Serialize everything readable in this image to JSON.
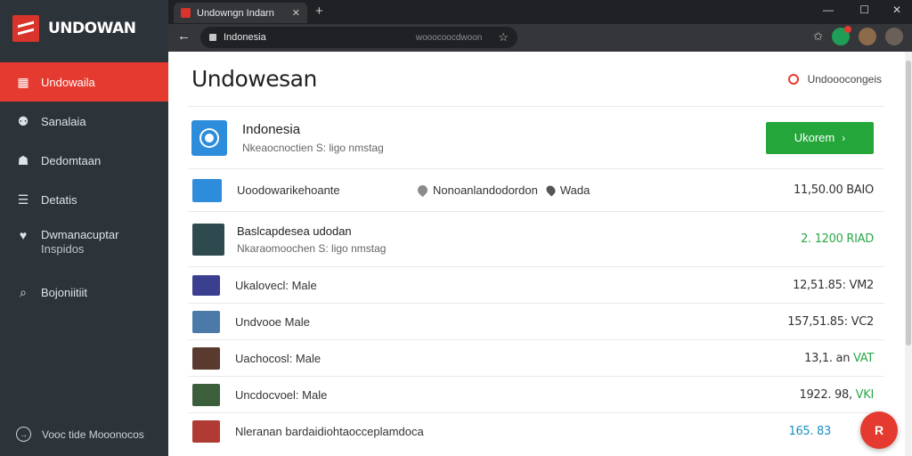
{
  "app": {
    "logo_text": "UNDOWAN"
  },
  "sidebar": {
    "items": [
      {
        "label": "Undowaila",
        "icon": "grid-icon"
      },
      {
        "label": "Sanalaia",
        "icon": "users-icon"
      },
      {
        "label": "Dedomtaan",
        "icon": "user-icon"
      },
      {
        "label": "Detatis",
        "icon": "list-icon"
      },
      {
        "label": "Dwmanacuptar",
        "label2": "Inspidos",
        "icon": "heart-icon"
      },
      {
        "label": "Bojoniitiit",
        "icon": "search-icon"
      }
    ],
    "footer_label": "Vooc tide Mooonocos"
  },
  "browser": {
    "tab_title": "Undowngn Indarn",
    "address": "Indonesia",
    "address_right": "wooocoocdwoon"
  },
  "page": {
    "title": "Undowesan",
    "header_link": "Undooocongeis",
    "hero": {
      "title": "Indonesia",
      "subtitle": "Nkeaocnoctien S: ligo nmstag",
      "cta": "Ukorem"
    },
    "rows": [
      {
        "name": "Uoodowarikehoante",
        "location": "Nonoanlandodordon",
        "location2": "Wada",
        "value": "11,50.00 BAIO",
        "value_color": "dark"
      },
      {
        "name": "Baslcapdesea udodan",
        "subtitle": "Nkaraomoochen S: ligo nmstag",
        "value": "2. 1200 RIAD",
        "value_color": "green"
      },
      {
        "name": "Ukalovecl: Male",
        "value": "12,51.85: VM2",
        "value_color": "dark"
      },
      {
        "name": "Undvooe Male",
        "value": "157,51.85: VC2",
        "value_color": "dark"
      },
      {
        "name": "Uachocosl: Male",
        "value": "13,1. an",
        "value_suffix": "VAT",
        "value_color": "dark"
      },
      {
        "name": "Uncdocvoel: Male",
        "value": "1922. 98,",
        "value_suffix": "VKI",
        "value_color": "dark"
      },
      {
        "name": "Nleranan bardaidiohtaocceplamdoca",
        "value": "165. 83",
        "value_color": "teal"
      }
    ],
    "fab_label": "R"
  },
  "colors": {
    "sidebar_bg": "#2c3339",
    "accent_red": "#e53a2f",
    "cta_green": "#24a63b",
    "value_green": "#2ba84a",
    "value_teal": "#1a8fc2"
  }
}
